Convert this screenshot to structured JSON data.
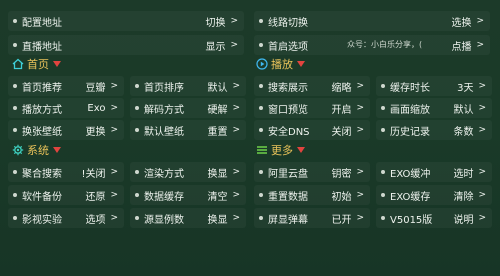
{
  "top": [
    {
      "label": "配置地址",
      "value": "切换"
    },
    {
      "label": "线路切换",
      "value": "选换"
    },
    {
      "label": "直播地址",
      "value": "显示"
    },
    {
      "label": "首启选项",
      "value": "点播"
    }
  ],
  "marquee": "众号：小白乐分享，(",
  "sections": {
    "home": {
      "title": "首页",
      "icon": "home-icon"
    },
    "play": {
      "title": "播放",
      "icon": "play-icon"
    },
    "system": {
      "title": "系统",
      "icon": "gear-icon"
    },
    "more": {
      "title": "更多",
      "icon": "more-icon"
    }
  },
  "grid": [
    [
      {
        "label": "首页推荐",
        "value": "豆瓣"
      },
      {
        "label": "首页排序",
        "value": "默认"
      },
      {
        "label": "搜索展示",
        "value": "缩略"
      },
      {
        "label": "缓存时长",
        "value": "3天"
      }
    ],
    [
      {
        "label": "播放方式",
        "value": "Exo"
      },
      {
        "label": "解码方式",
        "value": "硬解"
      },
      {
        "label": "窗口预览",
        "value": "开启"
      },
      {
        "label": "画面缩放",
        "value": "默认"
      }
    ],
    [
      {
        "label": "换张壁纸",
        "value": "更换"
      },
      {
        "label": "默认壁纸",
        "value": "重置"
      },
      {
        "label": "安全DNS",
        "value": "关闭"
      },
      {
        "label": "历史记录",
        "value": "条数"
      }
    ],
    [
      {
        "label": "聚合搜索",
        "value": "!关闭"
      },
      {
        "label": "渲染方式",
        "value": "换显"
      },
      {
        "label": "阿里云盘",
        "value": "钥密"
      },
      {
        "label": "EXO缓冲",
        "value": "选时"
      }
    ],
    [
      {
        "label": "软件备份",
        "value": "还原"
      },
      {
        "label": "数据缓存",
        "value": "清空"
      },
      {
        "label": "重置数据",
        "value": "初始"
      },
      {
        "label": "EXO缓存",
        "value": "清除"
      }
    ],
    [
      {
        "label": "影视实验",
        "value": "选项"
      },
      {
        "label": "源显例数",
        "value": "换显"
      },
      {
        "label": "屏显弹幕",
        "value": "已开"
      },
      {
        "label": "V5015版",
        "value": "说明"
      }
    ]
  ],
  "arrow": ">",
  "colors": {
    "bg": "#1b3a28",
    "section_title": "#e8c25a",
    "triangle": "#e2443f",
    "home_icon": "#3ed0d8",
    "play_icon": "#3fb8f0",
    "gear_icon": "#3ed0c0",
    "more_icon": "#6fd14a"
  }
}
